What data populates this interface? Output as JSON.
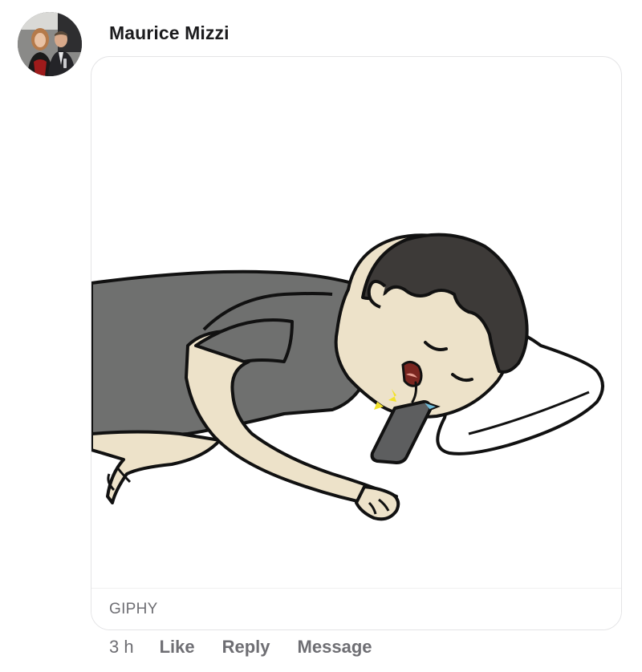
{
  "comment": {
    "author": "Maurice Mizzi",
    "attachment": {
      "source_label": "GIPHY"
    },
    "timestamp": "3 h",
    "actions": {
      "like": "Like",
      "reply": "Reply",
      "message": "Message"
    }
  },
  "colors": {
    "card_border": "#e4e4e6",
    "secondary_text": "#6e6e73",
    "author_text": "#1c1c1e",
    "shirt": "#6f706f",
    "skin": "#ede2c9",
    "hair": "#3d3a38"
  }
}
